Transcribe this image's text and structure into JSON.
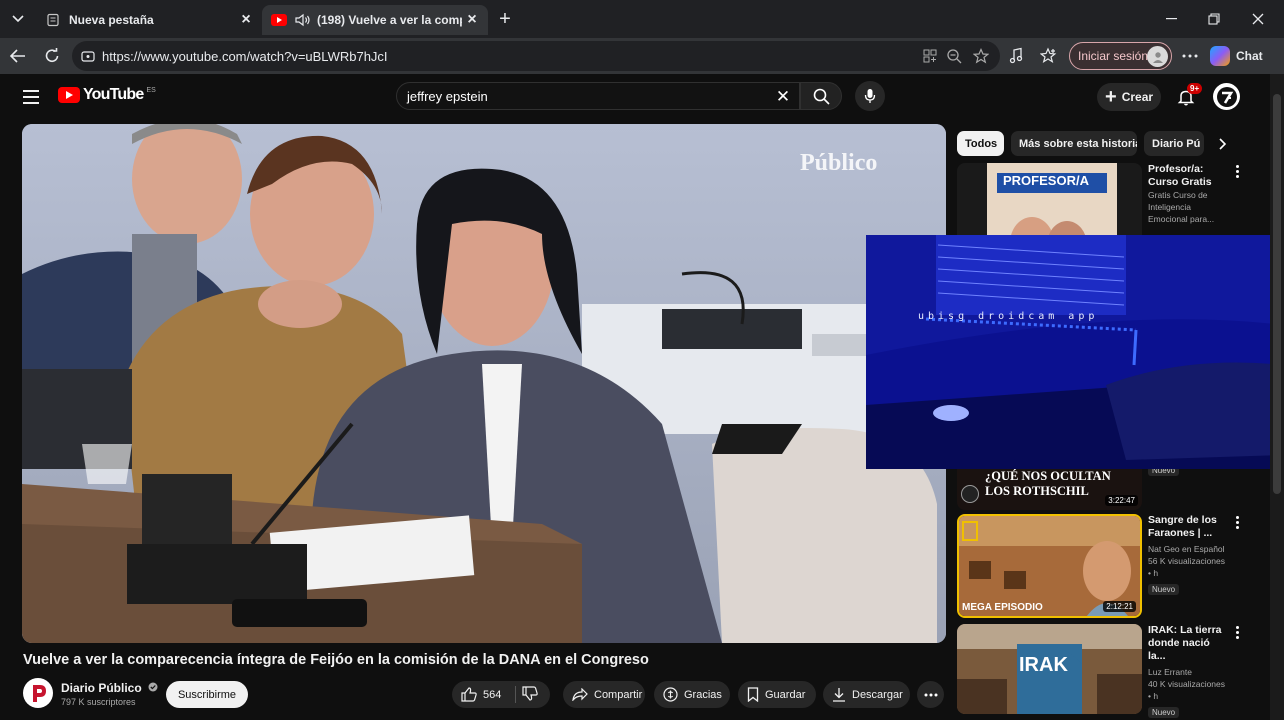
{
  "browser": {
    "tabs": [
      {
        "title": "Nueva pestaña",
        "active": false
      },
      {
        "title": "(198) Vuelve a ver la compare",
        "active": true
      }
    ],
    "url": "https://www.youtube.com/watch?v=uBLWRb7hJcI",
    "signin_label": "Iniciar sesión",
    "chat_label": "Chat"
  },
  "youtube": {
    "logo_text": "YouTube",
    "logo_country": "ES",
    "search_query": "jeffrey epstein",
    "create_label": "Crear",
    "notifications_badge": "9+"
  },
  "video": {
    "watermark": "Público",
    "title": "Vuelve a ver la comparecencia íntegra de Feijóo en la comisión de la DANA en el Congreso",
    "channel": "Diario Público",
    "subscribers": "797 K suscriptores",
    "subscribe_label": "Suscribirme",
    "likes": "564",
    "share_label": "Compartir",
    "thanks_label": "Gracias",
    "save_label": "Guardar",
    "download_label": "Descargar"
  },
  "sidebar": {
    "chips": [
      "Todos",
      "Más sobre esta historia",
      "Diario Pú"
    ],
    "recs": [
      {
        "thumb_text": "PROFESOR/A",
        "title": "Profesor/a: Curso Gratis",
        "meta": [
          "Gratis Curso de",
          "Inteligencia",
          "Emocional para..."
        ],
        "badge": ""
      },
      {
        "thumb_text": "¿QUÉ NOS OCULTAN LOS ROTHSCHIL",
        "title": "",
        "meta": [],
        "badge": "Nuevo",
        "duration": "3:22:47"
      },
      {
        "thumb_text": "MEGA EPISODIO",
        "title": "Sangre de los Faraones | ...",
        "meta": [
          "Nat Geo en Español",
          "56 K visualizaciones • h"
        ],
        "badge": "Nuevo",
        "duration": "2:12:21"
      },
      {
        "thumb_text": "IRAK",
        "title": "IRAK: La tierra donde nació la...",
        "meta": [
          "Luz Errante",
          "40 K visualizaciones • h"
        ],
        "badge": "Nuevo"
      }
    ],
    "miniplayer_text": "ubisg droidcam app"
  },
  "colors": {
    "yt_red": "#ff0000",
    "mini_blue": "#0a0f8a",
    "bg": "#0f0f0f"
  }
}
